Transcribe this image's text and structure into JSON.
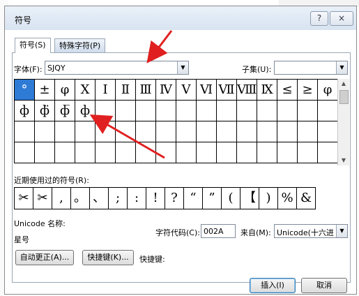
{
  "dialog": {
    "title": "符号",
    "help_button": "?",
    "close_button": "×"
  },
  "tabs": [
    {
      "label": "符号(S)"
    },
    {
      "label": "特殊字符(P)"
    }
  ],
  "font": {
    "label": "字体(F):",
    "value": "SJQY"
  },
  "subset": {
    "label": "子集(U):",
    "value": ""
  },
  "symbols": [
    [
      "°",
      "±",
      "φ",
      "Ⅹ",
      "Ⅰ",
      "Ⅱ",
      "Ⅲ",
      "Ⅳ",
      "Ⅴ",
      "Ⅵ",
      "Ⅶ",
      "Ⅷ",
      "Ⅸ",
      "≤",
      "≥",
      "φ"
    ],
    [
      "ф",
      "ф̈",
      "ф̅",
      "ф",
      "",
      "",
      "",
      "",
      "",
      "",
      "",
      "",
      "",
      "",
      "",
      ""
    ],
    [
      "",
      "",
      "",
      "",
      "",
      "",
      "",
      "",
      "",
      "",
      "",
      "",
      "",
      "",
      "",
      ""
    ],
    [
      "",
      "",
      "",
      "",
      "",
      "",
      "",
      "",
      "",
      "",
      "",
      "",
      "",
      "",
      "",
      ""
    ]
  ],
  "recent": {
    "label": "近期使用过的符号(R):",
    "items": [
      "✂",
      "✂",
      ",",
      "。",
      "、",
      ";",
      ":",
      "!",
      "?",
      "“",
      "”",
      "(",
      "【",
      ")",
      "%",
      "&"
    ]
  },
  "unicode": {
    "name_label": "Unicode 名称:",
    "name_value": "星号"
  },
  "char_code": {
    "label": "字符代码(C):",
    "value": "002A"
  },
  "from": {
    "label": "来自(M):",
    "value": "Unicode(十六进"
  },
  "buttons": {
    "autocorrect": "自动更正(A)...",
    "shortcut_key": "快捷键(K)...",
    "shortcut_label": "快捷键:",
    "insert": "插入(I)",
    "cancel": "取消"
  },
  "colors": {
    "selected": "#2e7bd6",
    "annotation_arrow": "#e02020"
  }
}
